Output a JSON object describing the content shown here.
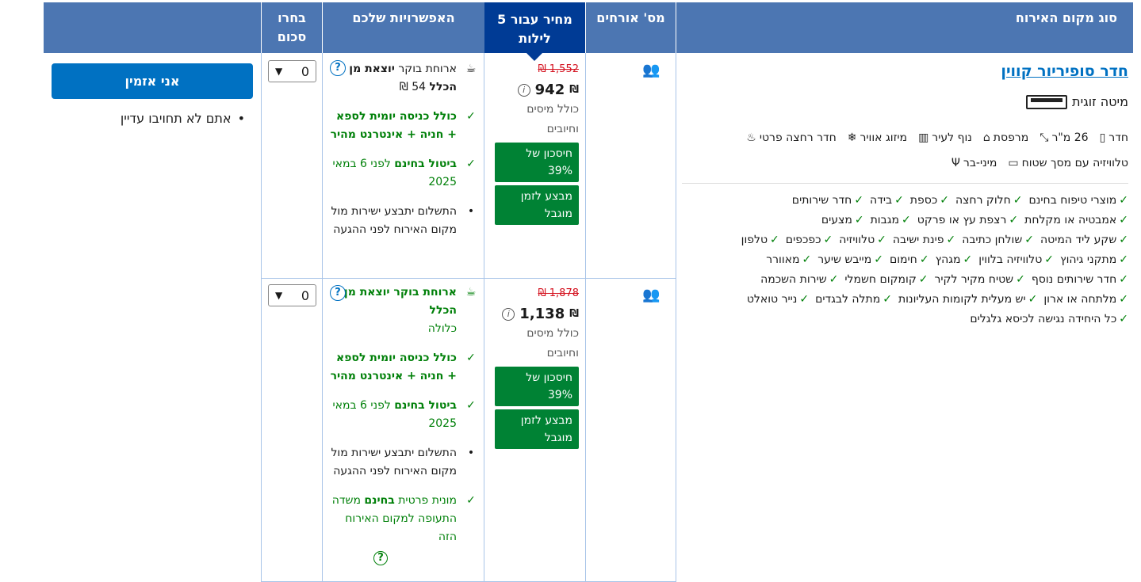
{
  "headers": {
    "room_type": "סוג מקום האירוח",
    "guests": "מס' אורחים",
    "price_line1": "מחיר עבור 5",
    "price_line2": "לילות",
    "options": "האפשרויות שלכם",
    "select_line1": "בחרו",
    "select_line2": "סכום"
  },
  "room": {
    "name": "חדר סופיריור קווין",
    "bed": "מיטה זוגית",
    "facilities_row1": [
      {
        "icon": "room-icon",
        "glyph": "▯",
        "label": "חדר"
      },
      {
        "icon": "size-icon",
        "glyph": "⤡",
        "label": "26 מ\"ר"
      },
      {
        "icon": "balcony-icon",
        "glyph": "⌂",
        "label": "מרפסת"
      },
      {
        "icon": "city-view-icon",
        "glyph": "▥",
        "label": "נוף לעיר"
      },
      {
        "icon": "ac-icon",
        "glyph": "❄",
        "label": "מיזוג אוויר"
      },
      {
        "icon": "bathroom-icon",
        "glyph": "♨",
        "label": "חדר רחצה פרטי"
      }
    ],
    "facilities_row2": [
      {
        "icon": "tv-icon",
        "glyph": "▭",
        "label": "טלוויזיה עם מסך שטוח"
      },
      {
        "icon": "minibar-icon",
        "glyph": "Ψ",
        "label": "מיני-בר"
      }
    ],
    "amenities": [
      [
        "מוצרי טיפוח בחינם",
        "חלוק רחצה",
        "כספת",
        "בידה",
        "חדר שירותים"
      ],
      [
        "אמבטיה או מקלחת",
        "רצפת עץ או פרקט",
        "מגבות",
        "מצעים"
      ],
      [
        "שקע ליד המיטה",
        "שולחן כתיבה",
        "פינת ישיבה",
        "טלוויזיה",
        "כפכפים",
        "טלפון"
      ],
      [
        "מתקני גיהוץ",
        "טלוויזיה בלווין",
        "מגהץ",
        "חימום",
        "מייבש שיער",
        "מאוורר"
      ],
      [
        "חדר שירותים נוסף",
        "שטיח מקיר לקיר",
        "קומקום חשמלי",
        "שירות השכמה"
      ],
      [
        "מלתחה או ארון",
        "יש מעלית לקומות העליונות",
        "מתלה לבגדים",
        "נייר טואלט"
      ],
      [
        "כל היחידה נגישה לכיסא גלגלים"
      ]
    ],
    "check": "✓"
  },
  "offers": [
    {
      "old_price": "₪ 1,552",
      "price": "942",
      "currency": "₪",
      "taxes1": "כולל מיסים",
      "taxes2": "וחיובים",
      "badge_saving": "חיסכון של 39%",
      "badge_limited": "מבצע לזמן מוגבל",
      "breakfast_a": "ארוחת בוקר ",
      "breakfast_b": "יוצאת מן הכלל",
      "breakfast_c": " 54 ₪",
      "spa": "כולל כניסה יומית לספא + חניה + אינטרנט מהיר",
      "cancel_bold": "ביטול בחינם",
      "cancel_rest": " לפני 6 במאי 2025",
      "payment": "התשלום יתבצע ישירות מול מקום האירוח לפני ההגעה",
      "qty": "0"
    },
    {
      "old_price": "₪ 1,878",
      "price": "1,138",
      "currency": "₪",
      "taxes1": "כולל מיסים",
      "taxes2": "וחיובים",
      "badge_saving": "חיסכון של 39%",
      "badge_limited": "מבצע לזמן מוגבל",
      "breakfast_bold": "ארוחת בוקר יוצאת מן הכלל",
      "breakfast_incl": "כלולה",
      "spa": "כולל כניסה יומית לספא + חניה + אינטרנט מהיר",
      "cancel_bold": "ביטול בחינם",
      "cancel_rest": " לפני 6 במאי 2025",
      "payment": "התשלום יתבצע ישירות מול מקום האירוח לפני ההגעה",
      "taxi_a": "מונית פרטית ",
      "taxi_b": "בחינם",
      "taxi_c": " משדה התעופה למקום האירוח הזה",
      "qty": "0"
    }
  ],
  "reserve_label": "אני אזמין",
  "note": "אתם לא תחויבו עדיין",
  "colors": {
    "header": "#4c76b2",
    "price_header": "#003b95",
    "green": "#008009",
    "badge": "#008234",
    "link": "#0071c2",
    "old_price": "#d4111e"
  }
}
